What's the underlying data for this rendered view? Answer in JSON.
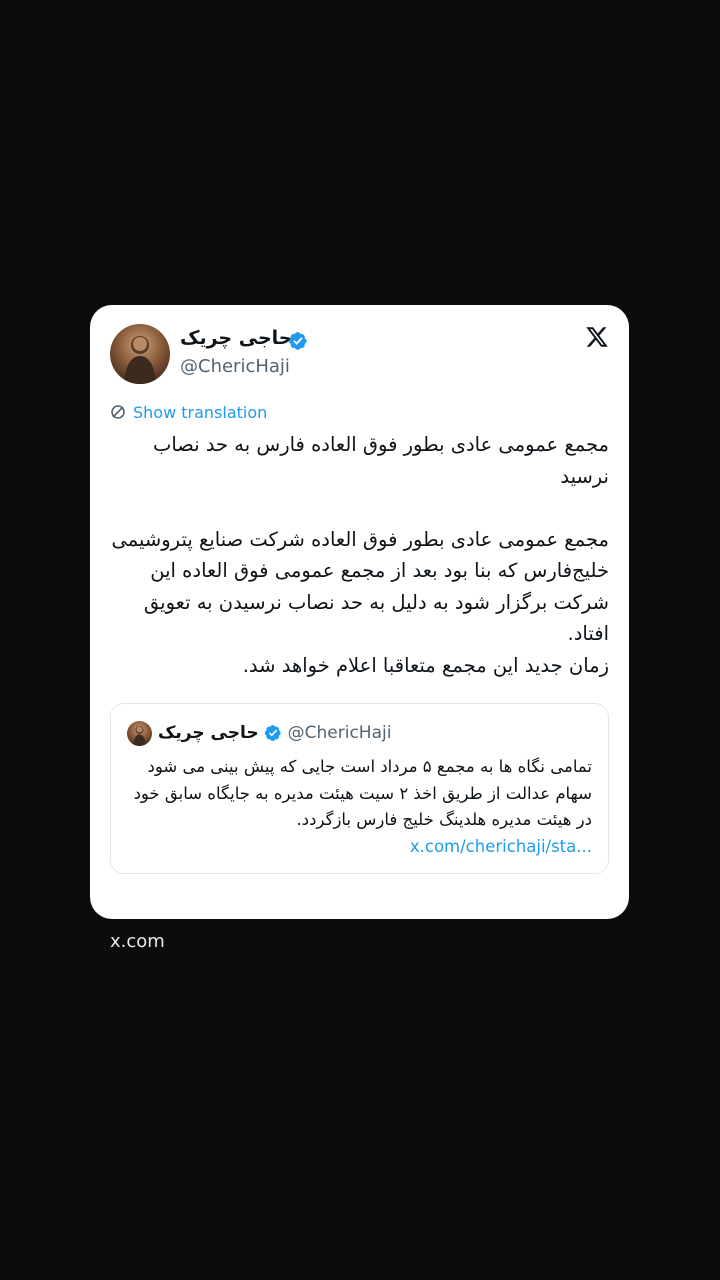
{
  "tweet": {
    "display_name": "حاجی چریک",
    "handle": "@ChericHaji",
    "translate_label": "Show translation",
    "paragraph_1": "مجمع عمومی عادی بطور فوق العاده فارس به حد نصاب نرسید",
    "paragraph_2": "مجمع عمومی عادی بطور فوق العاده شرکت صنایع پتروشیمی خلیج‌فارس که بنا بود بعد از مجمع عمومی فوق العاده این شرکت برگزار شود به دلیل به حد نصاب نرسیدن به تعویق افتاد.",
    "paragraph_3": "زمان جدید این مجمع متعاقبا اعلام خواهد شد.",
    "icons": {
      "verified": "verified-badge-icon",
      "logo": "x-logo-icon",
      "translate": "translate-icon"
    }
  },
  "quoted_tweet": {
    "display_name": "حاجی چریک",
    "handle": "@ChericHaji",
    "text": "تمامی نگاه ها به مجمع ۵ مرداد است جایی که پیش بینی می شود سهام عدالت از طریق اخذ ۲ سیت هیئت مدیره به جایگاه سابق خود در هیئت مدیره هلدینگ خلیج فارس بازگردد.",
    "link": "x.com/cherichaji/sta..."
  },
  "source_label": "x.com",
  "colors": {
    "background": "#0c0c0c",
    "card": "#ffffff",
    "accent": "#1d9bf0",
    "text": "#0f1419",
    "secondary": "#536471"
  }
}
